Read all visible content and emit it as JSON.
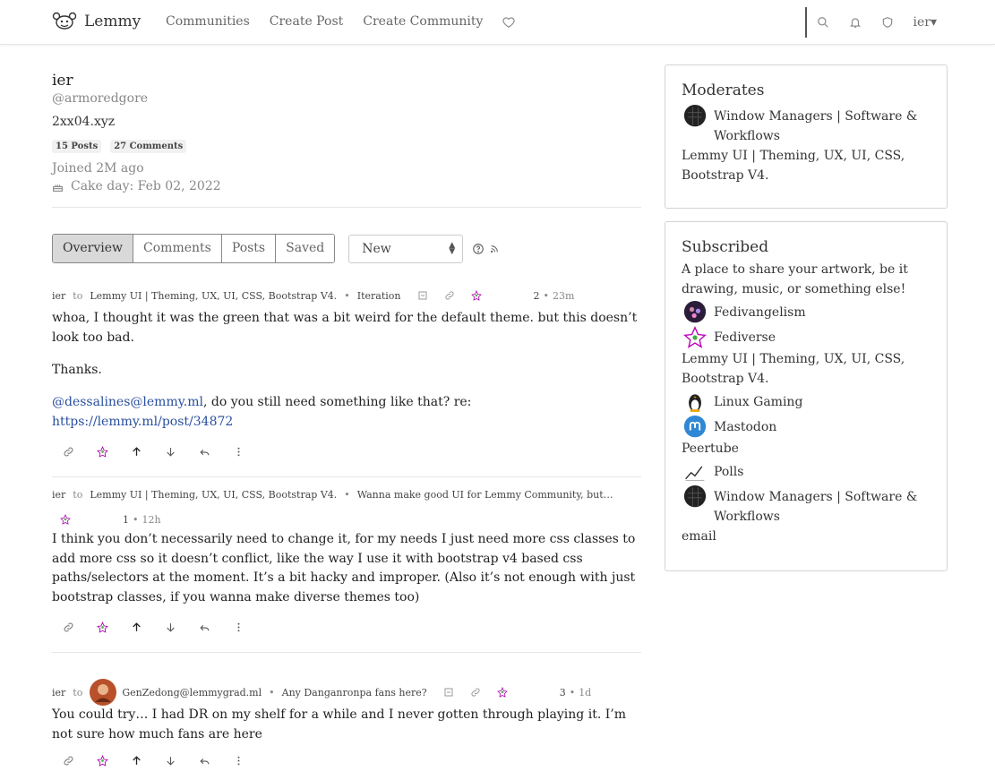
{
  "nav": {
    "brand": "Lemmy",
    "links": [
      "Communities",
      "Create Post",
      "Create Community"
    ],
    "user": "ier"
  },
  "profile": {
    "name": "ier",
    "handle": "@armoredgore",
    "bio": "2xx04.xyz",
    "posts_badge": "15 Posts",
    "comments_badge": "27 Comments",
    "joined": "Joined 2M ago",
    "cake_day": "Cake day: Feb 02, 2022"
  },
  "tabs": [
    "Overview",
    "Comments",
    "Posts",
    "Saved"
  ],
  "sort": "New",
  "comments": [
    {
      "user": "ier",
      "to": "to",
      "community": "Lemmy UI | Theming, UX, UI, CSS, Bootstrap V4.",
      "post_title": "Iteration",
      "score": "2",
      "time": "23m",
      "paragraphs": [
        "whoa, I thought it was the green that was a bit weird for the default theme. but this doesn’t look too bad.",
        "Thanks."
      ],
      "mention": "@dessalines@lemmy.ml",
      "after_mention": ", do you still need something like that? re: ",
      "link": "https://lemmy.ml/post/34872"
    },
    {
      "user": "ier",
      "to": "to",
      "community": "Lemmy UI | Theming, UX, UI, CSS, Bootstrap V4.",
      "post_title": "Wanna make good UI for Lemmy Community, but…",
      "score": "1",
      "time": "12h",
      "body": "I think you don’t necessarily need to change it, for my needs I just need more css classes to add more css so it doesn’t conflict, like the way I use it with bootstrap v4 based css paths/selectors at the moment. It’s a bit hacky and improper. (Also it’s not enough with just bootstrap classes, if you wanna make diverse themes too)"
    },
    {
      "user": "ier",
      "to": "to",
      "recipient": "GenZedong@lemmygrad.ml",
      "post_title": "Any Danganronpa fans here?",
      "score": "3",
      "time": "1d",
      "body": "You could try… I had DR on my shelf for a while and I never gotten through playing it. I’m not sure how much fans are here"
    }
  ],
  "moderates": {
    "title": "Moderates",
    "items": [
      "Window Managers | Software & Workflows",
      "Lemmy UI | Theming, UX, UI, CSS, Bootstrap V4."
    ]
  },
  "subscribed": {
    "title": "Subscribed",
    "items": [
      "A place to share your artwork, be it drawing, music, or something else!",
      "Fedivangelism",
      "Fediverse",
      "Lemmy UI | Theming, UX, UI, CSS, Bootstrap V4.",
      "Linux Gaming",
      "Mastodon",
      "Peertube",
      "Polls",
      "Window Managers | Software & Workflows",
      "email"
    ]
  }
}
